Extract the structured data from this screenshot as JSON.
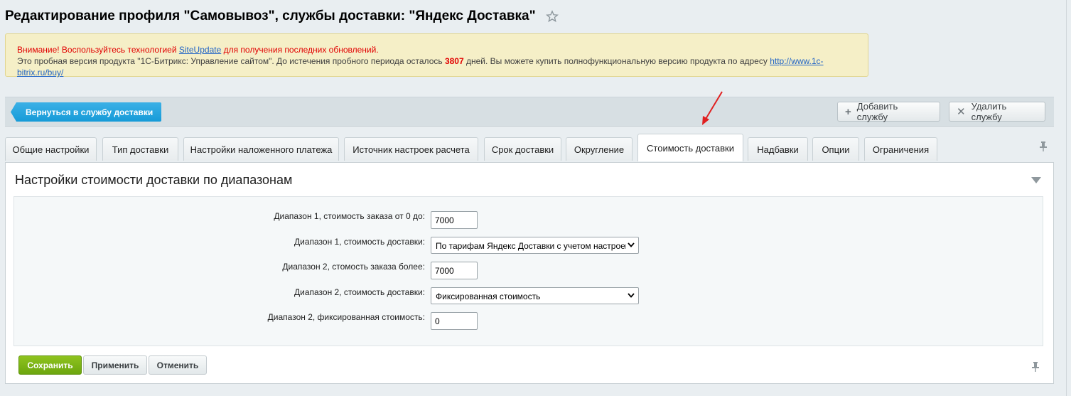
{
  "header": {
    "title": "Редактирование профиля \"Самовывоз\", службы доставки: \"Яндекс Доставка\""
  },
  "notice": {
    "warning_prefix": "Внимание! Воспользуйтесь технологией ",
    "warning_link": "SiteUpdate",
    "warning_suffix": " для получения последних обновлений.",
    "trial_prefix": "Это пробная версия продукта \"1С-Битрикс: Управление сайтом\". До истечения пробного периода осталось ",
    "trial_days": "3807",
    "trial_middle": " дней. Вы можете купить полнофункциональную версию продукта по адресу ",
    "trial_link": "http://www.1c-bitrix.ru/buy/"
  },
  "toolbar": {
    "back_label": "Вернуться в службу доставки",
    "add_label": "Добавить службу",
    "delete_label": "Удалить службу"
  },
  "tabs": [
    {
      "label": "Общие настройки"
    },
    {
      "label": "Тип доставки"
    },
    {
      "label": "Настройки наложенного платежа"
    },
    {
      "label": "Источник настроек расчета"
    },
    {
      "label": "Срок доставки"
    },
    {
      "label": "Округление"
    },
    {
      "label": "Стоимость доставки",
      "active": true
    },
    {
      "label": "Надбавки"
    },
    {
      "label": "Опции"
    },
    {
      "label": "Ограничения"
    }
  ],
  "section": {
    "title": "Настройки стоимости доставки по диапазонам"
  },
  "form": {
    "range1_order_label": "Диапазон 1, стоимость заказа от 0 до:",
    "range1_order_value": "7000",
    "range1_cost_label": "Диапазон 1, стоимость доставки:",
    "range1_cost_value": "По тарифам Яндекс Доставки с учетом настроек",
    "range2_order_label": "Диапазон 2, стомость заказа более:",
    "range2_order_value": "7000",
    "range2_cost_label": "Диапазон 2, стоимость доставки:",
    "range2_cost_value": "Фиксированная стоимость",
    "range2_fixed_label": "Диапазон 2, фиксированная стоимость:",
    "range2_fixed_value": "0"
  },
  "footer": {
    "save_label": "Сохранить",
    "apply_label": "Применить",
    "cancel_label": "Отменить"
  },
  "colors": {
    "accent_blue": "#169bd8",
    "save_green": "#7cb518",
    "warning_red": "#e10000",
    "annotation_arrow": "#e02020"
  },
  "icons": [
    "star-icon",
    "plus-icon",
    "close-icon",
    "pin-icon",
    "chevron-down-icon",
    "arrow-annotation"
  ]
}
